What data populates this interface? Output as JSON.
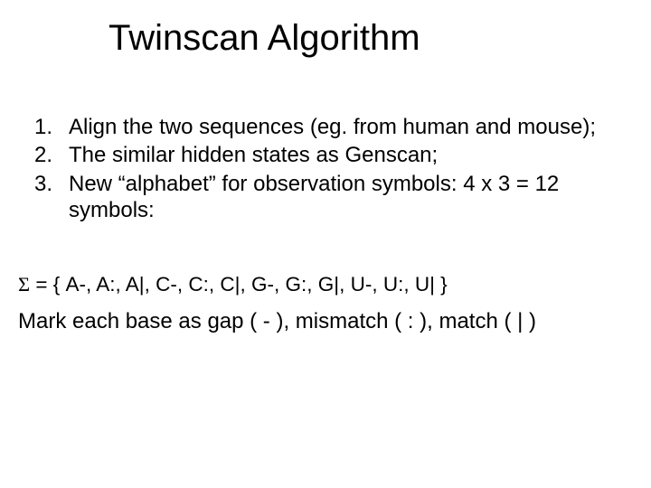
{
  "title": "Twinscan Algorithm",
  "items": [
    {
      "num": "1.",
      "text": "Align the two sequences (eg. from human and mouse);"
    },
    {
      "num": "2.",
      "text": "The similar hidden states as Genscan;"
    },
    {
      "num": "3.",
      "text": "New “alphabet” for observation symbols: 4 x 3 = 12 symbols:"
    }
  ],
  "alphabet_line_prefix": "Σ",
  "alphabet_line_rest": " = { A-, A:, A|, C-, C:, C|, G-, G:, G|, U-, U:, U| }",
  "mark_line": "Mark each base as gap ( - ), mismatch ( : ), match ( | )"
}
